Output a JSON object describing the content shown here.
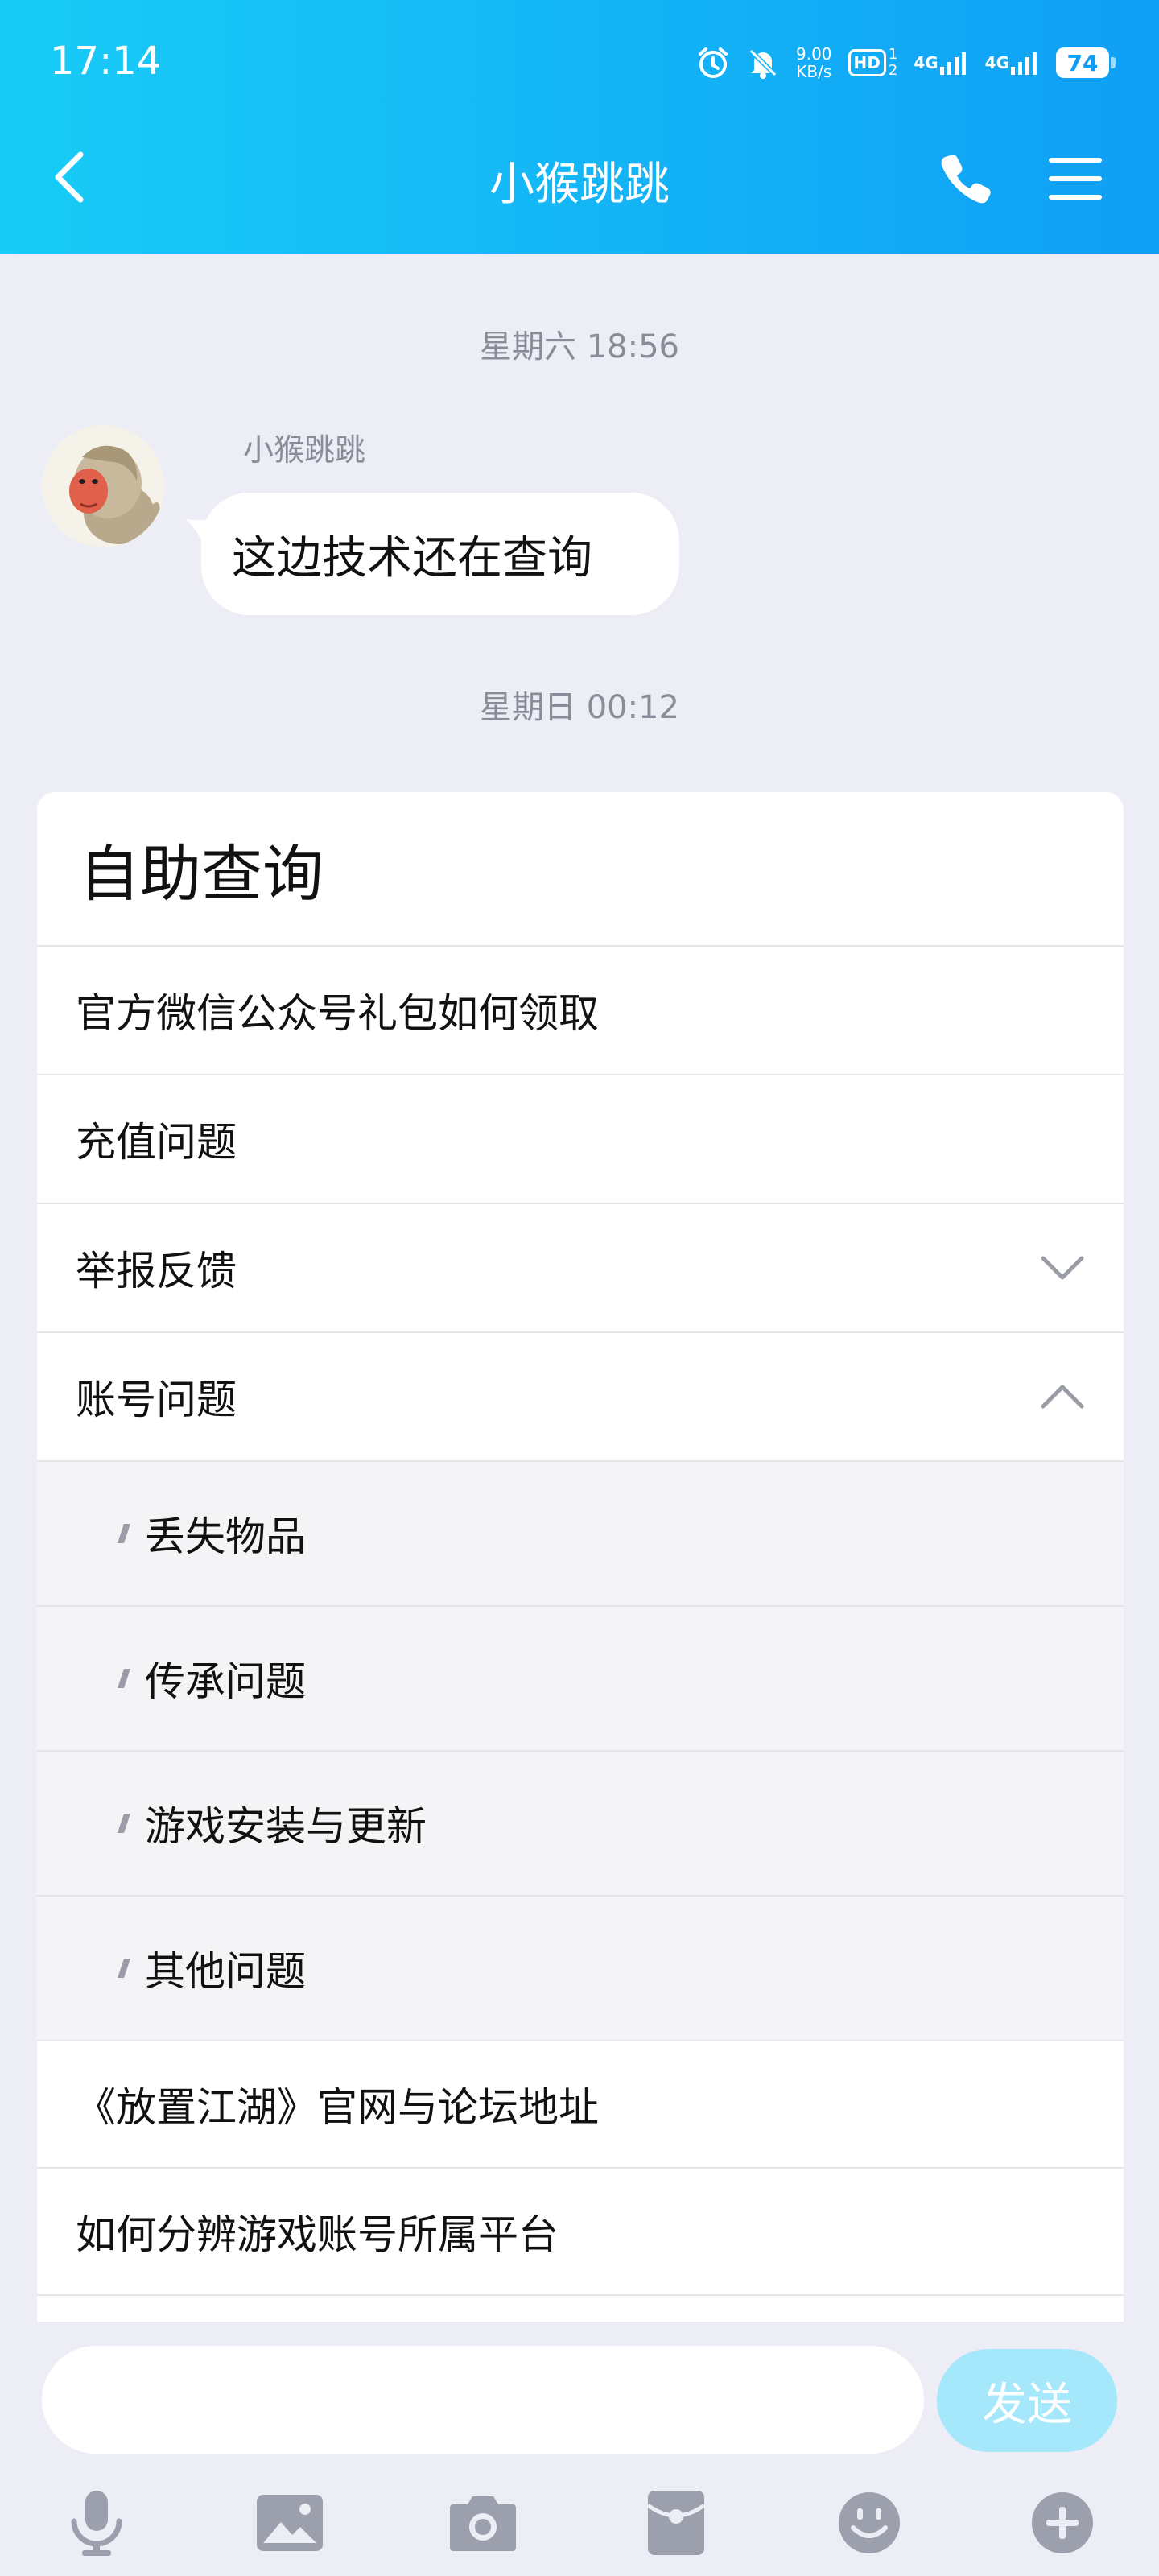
{
  "status_bar": {
    "time": "17:14",
    "net_speed_value": "9.00",
    "net_speed_unit": "KB/s",
    "hd_label": "HD",
    "sim1_label": "4G",
    "sim2_label": "4G",
    "battery": "74",
    "icons": [
      "alarm-icon",
      "mute-icon",
      "hd-icon",
      "signal-icon",
      "signal-icon",
      "battery-icon"
    ]
  },
  "header": {
    "title": "小猴跳跳",
    "back_icon": "chevron-left-icon",
    "phone_icon": "phone-icon",
    "menu_icon": "menu-icon"
  },
  "chat": {
    "timestamp_1": "星期六  18:56",
    "sender_name": "小猴跳跳",
    "message_text": "这边技术还在查询",
    "timestamp_2": "星期日  00:12"
  },
  "card": {
    "title": "自助查询",
    "items": [
      {
        "label": "官方微信公众号礼包如何领取"
      },
      {
        "label": "充值问题"
      },
      {
        "label": "举报反馈",
        "chevron": "chevron-down-icon"
      },
      {
        "label": "账号问题",
        "chevron": "chevron-up-icon"
      }
    ],
    "subitems": [
      {
        "label": "丢失物品"
      },
      {
        "label": "传承问题"
      },
      {
        "label": "游戏安装与更新"
      },
      {
        "label": "其他问题"
      }
    ],
    "items_after": [
      {
        "label": "《放置江湖》官网与论坛地址"
      },
      {
        "label": "如何分辨游戏账号所属平台"
      }
    ]
  },
  "input": {
    "value": "",
    "placeholder": "",
    "send_label": "发送"
  },
  "toolbar": {
    "icons": [
      "microphone-icon",
      "image-icon",
      "camera-icon",
      "red-packet-icon",
      "emoji-icon",
      "plus-icon"
    ]
  },
  "colors": {
    "header_start": "#18ccf6",
    "header_end": "#0f9ff5",
    "send_button": "#a6e8fb",
    "toolbar_icon": "#9ca0ad",
    "background": "#ecedf5"
  }
}
